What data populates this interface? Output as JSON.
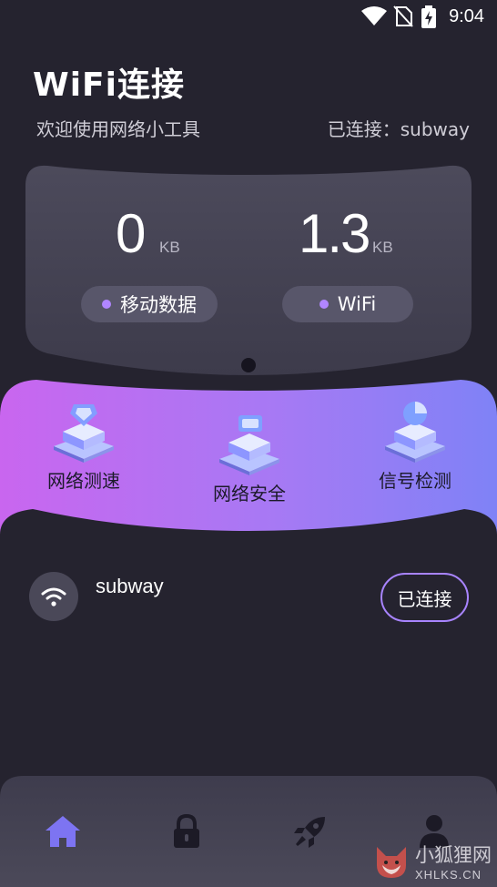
{
  "status_bar": {
    "time": "9:04"
  },
  "header": {
    "title": "WiFi连接",
    "welcome": "欢迎使用网络小工具",
    "connected_label": "已连接：subway"
  },
  "stats": {
    "mobile": {
      "value": "0",
      "unit": "KB",
      "label": "移动数据"
    },
    "wifi": {
      "value": "1.3",
      "unit": "KB",
      "label": "WiFi"
    }
  },
  "features": [
    {
      "label": "网络测速",
      "icon": "speed-test-icon"
    },
    {
      "label": "网络安全",
      "icon": "network-security-icon"
    },
    {
      "label": "信号检测",
      "icon": "signal-detect-icon"
    }
  ],
  "network": {
    "ssid": "subway",
    "button_label": "已连接",
    "icon": "wifi-icon"
  },
  "nav": [
    {
      "name": "home",
      "icon": "home-icon",
      "active": true
    },
    {
      "name": "security",
      "icon": "lock-icon",
      "active": false
    },
    {
      "name": "boost",
      "icon": "rocket-icon",
      "active": false
    },
    {
      "name": "profile",
      "icon": "user-icon",
      "active": false
    }
  ],
  "watermark": {
    "top": "小狐狸网",
    "bottom": "XHLKS.CN"
  },
  "colors": {
    "background": "#25232f",
    "card": "#4a4859",
    "accent_purple": "#a884ff",
    "band_gradient_start": "#c866f0",
    "band_gradient_end": "#7e7bf5",
    "nav_active": "#7d74f2"
  }
}
